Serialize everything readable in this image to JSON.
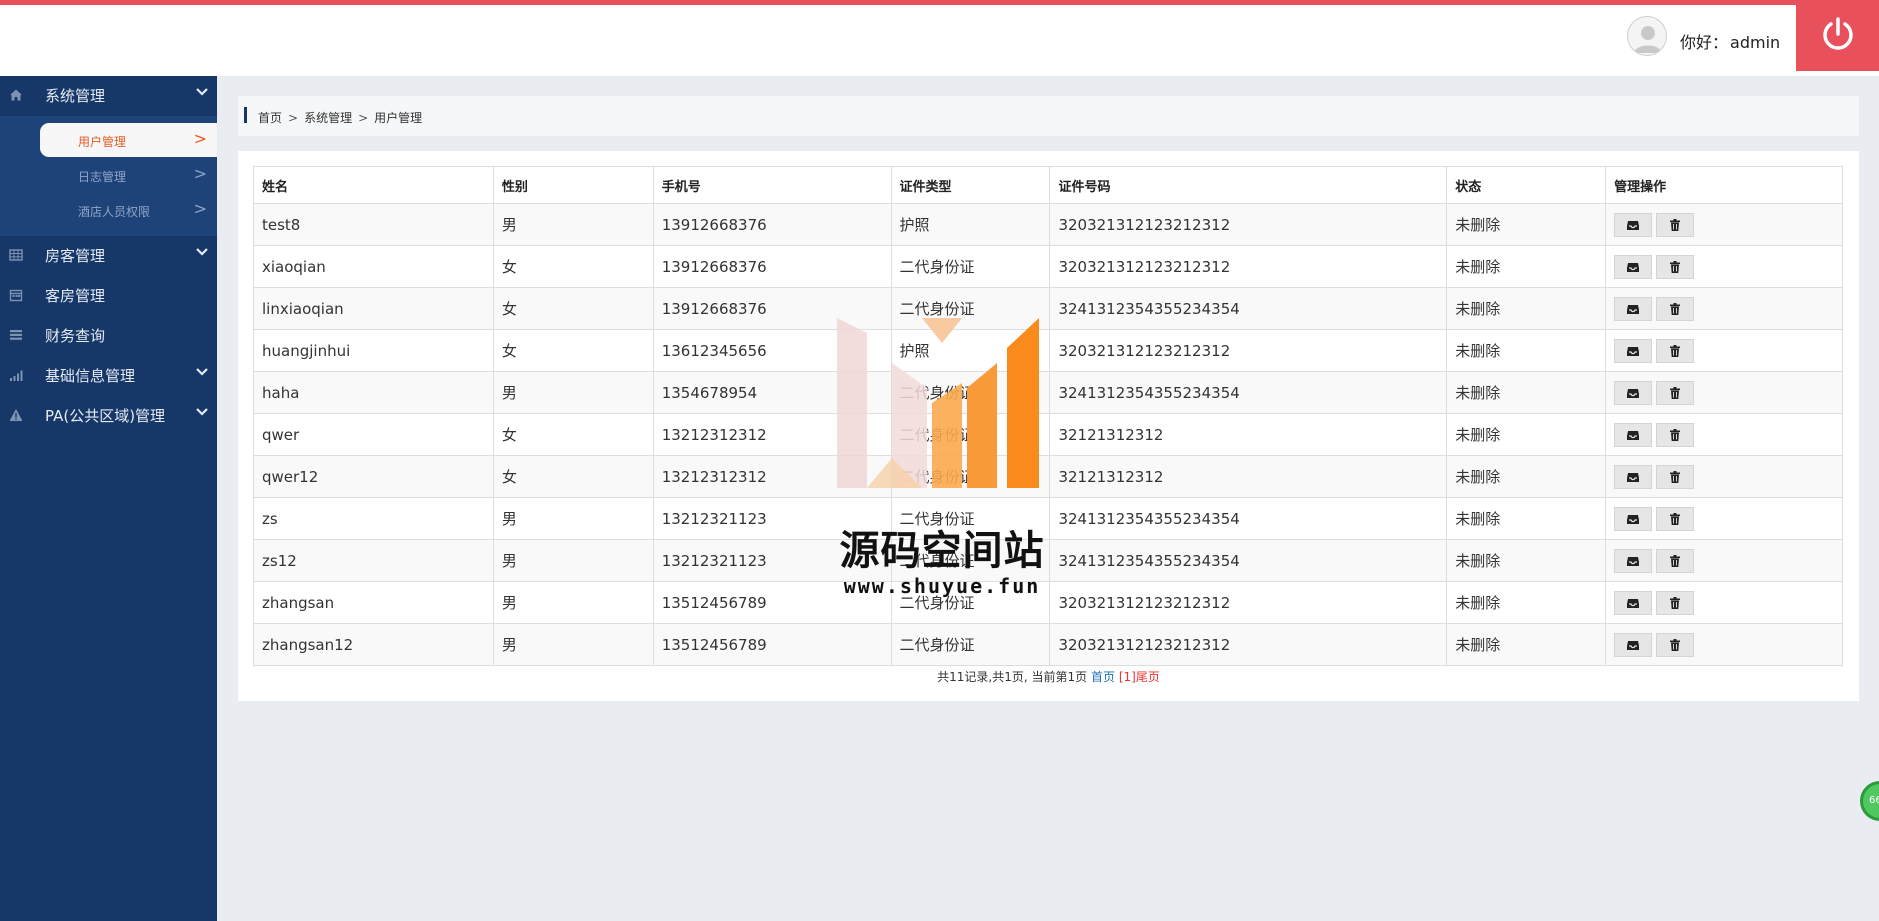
{
  "header": {
    "greeting": "你好：",
    "username": "admin",
    "avatar_icon": "user-avatar-icon",
    "logout_icon": "power-icon",
    "accent_color": "#e8505b"
  },
  "sidebar": {
    "background": "#163768",
    "items": [
      {
        "label": "系统管理",
        "icon": "home-icon",
        "has_children": true
      },
      {
        "label": "房客管理",
        "icon": "table-icon",
        "has_children": true
      },
      {
        "label": "客房管理",
        "icon": "calendar-icon",
        "has_children": false
      },
      {
        "label": "财务查询",
        "icon": "list-icon",
        "has_children": false
      },
      {
        "label": "基础信息管理",
        "icon": "signal-icon",
        "has_children": true
      },
      {
        "label": "PA(公共区域)管理",
        "icon": "warning-icon",
        "has_children": true
      }
    ],
    "subitems": [
      {
        "label": "用户管理",
        "arrow": ">",
        "active": true
      },
      {
        "label": "日志管理",
        "arrow": ">",
        "active": false
      },
      {
        "label": "酒店人员权限",
        "arrow": ">",
        "active": false
      }
    ]
  },
  "breadcrumb": {
    "items": [
      "首页",
      "系统管理",
      "用户管理"
    ],
    "separator": ">"
  },
  "table": {
    "columns": [
      "姓名",
      "性别",
      "手机号",
      "证件类型",
      "证件号码",
      "状态",
      "管理操作"
    ],
    "rows": [
      [
        "test8",
        "男",
        "13912668376",
        "护照",
        "320321312123212312",
        "未删除"
      ],
      [
        "xiaoqian",
        "女",
        "13912668376",
        "二代身份证",
        "320321312123212312",
        "未删除"
      ],
      [
        "linxiaoqian",
        "女",
        "13912668376",
        "二代身份证",
        "3241312354355234354",
        "未删除"
      ],
      [
        "huangjinhui",
        "女",
        "13612345656",
        "护照",
        "320321312123212312",
        "未删除"
      ],
      [
        "haha",
        "男",
        "1354678954",
        "二代身份证",
        "3241312354355234354",
        "未删除"
      ],
      [
        "qwer",
        "女",
        "13212312312",
        "二代身份证",
        "32121312312",
        "未删除"
      ],
      [
        "qwer12",
        "女",
        "13212312312",
        "二代身份证",
        "32121312312",
        "未删除"
      ],
      [
        "zs",
        "男",
        "13212321123",
        "二代身份证",
        "3241312354355234354",
        "未删除"
      ],
      [
        "zs12",
        "男",
        "13212321123",
        "二代身份证",
        "3241312354355234354",
        "未删除"
      ],
      [
        "zhangsan",
        "男",
        "13512456789",
        "二代身份证",
        "320321312123212312",
        "未删除"
      ],
      [
        "zhangsan12",
        "男",
        "13512456789",
        "二代身份证",
        "320321312123212312",
        "未删除"
      ]
    ],
    "row_actions": [
      {
        "icon": "inbox-icon",
        "name": "edit-button"
      },
      {
        "icon": "trash-icon",
        "name": "delete-button"
      }
    ]
  },
  "pager": {
    "summary": "共11记录,共1页, 当前第1页",
    "first": "首页",
    "current": "[1]",
    "last": "尾页"
  },
  "watermark": {
    "title": "源码空间站",
    "url": "www.shuyue.fun"
  },
  "float_badge": {
    "text": "66"
  }
}
